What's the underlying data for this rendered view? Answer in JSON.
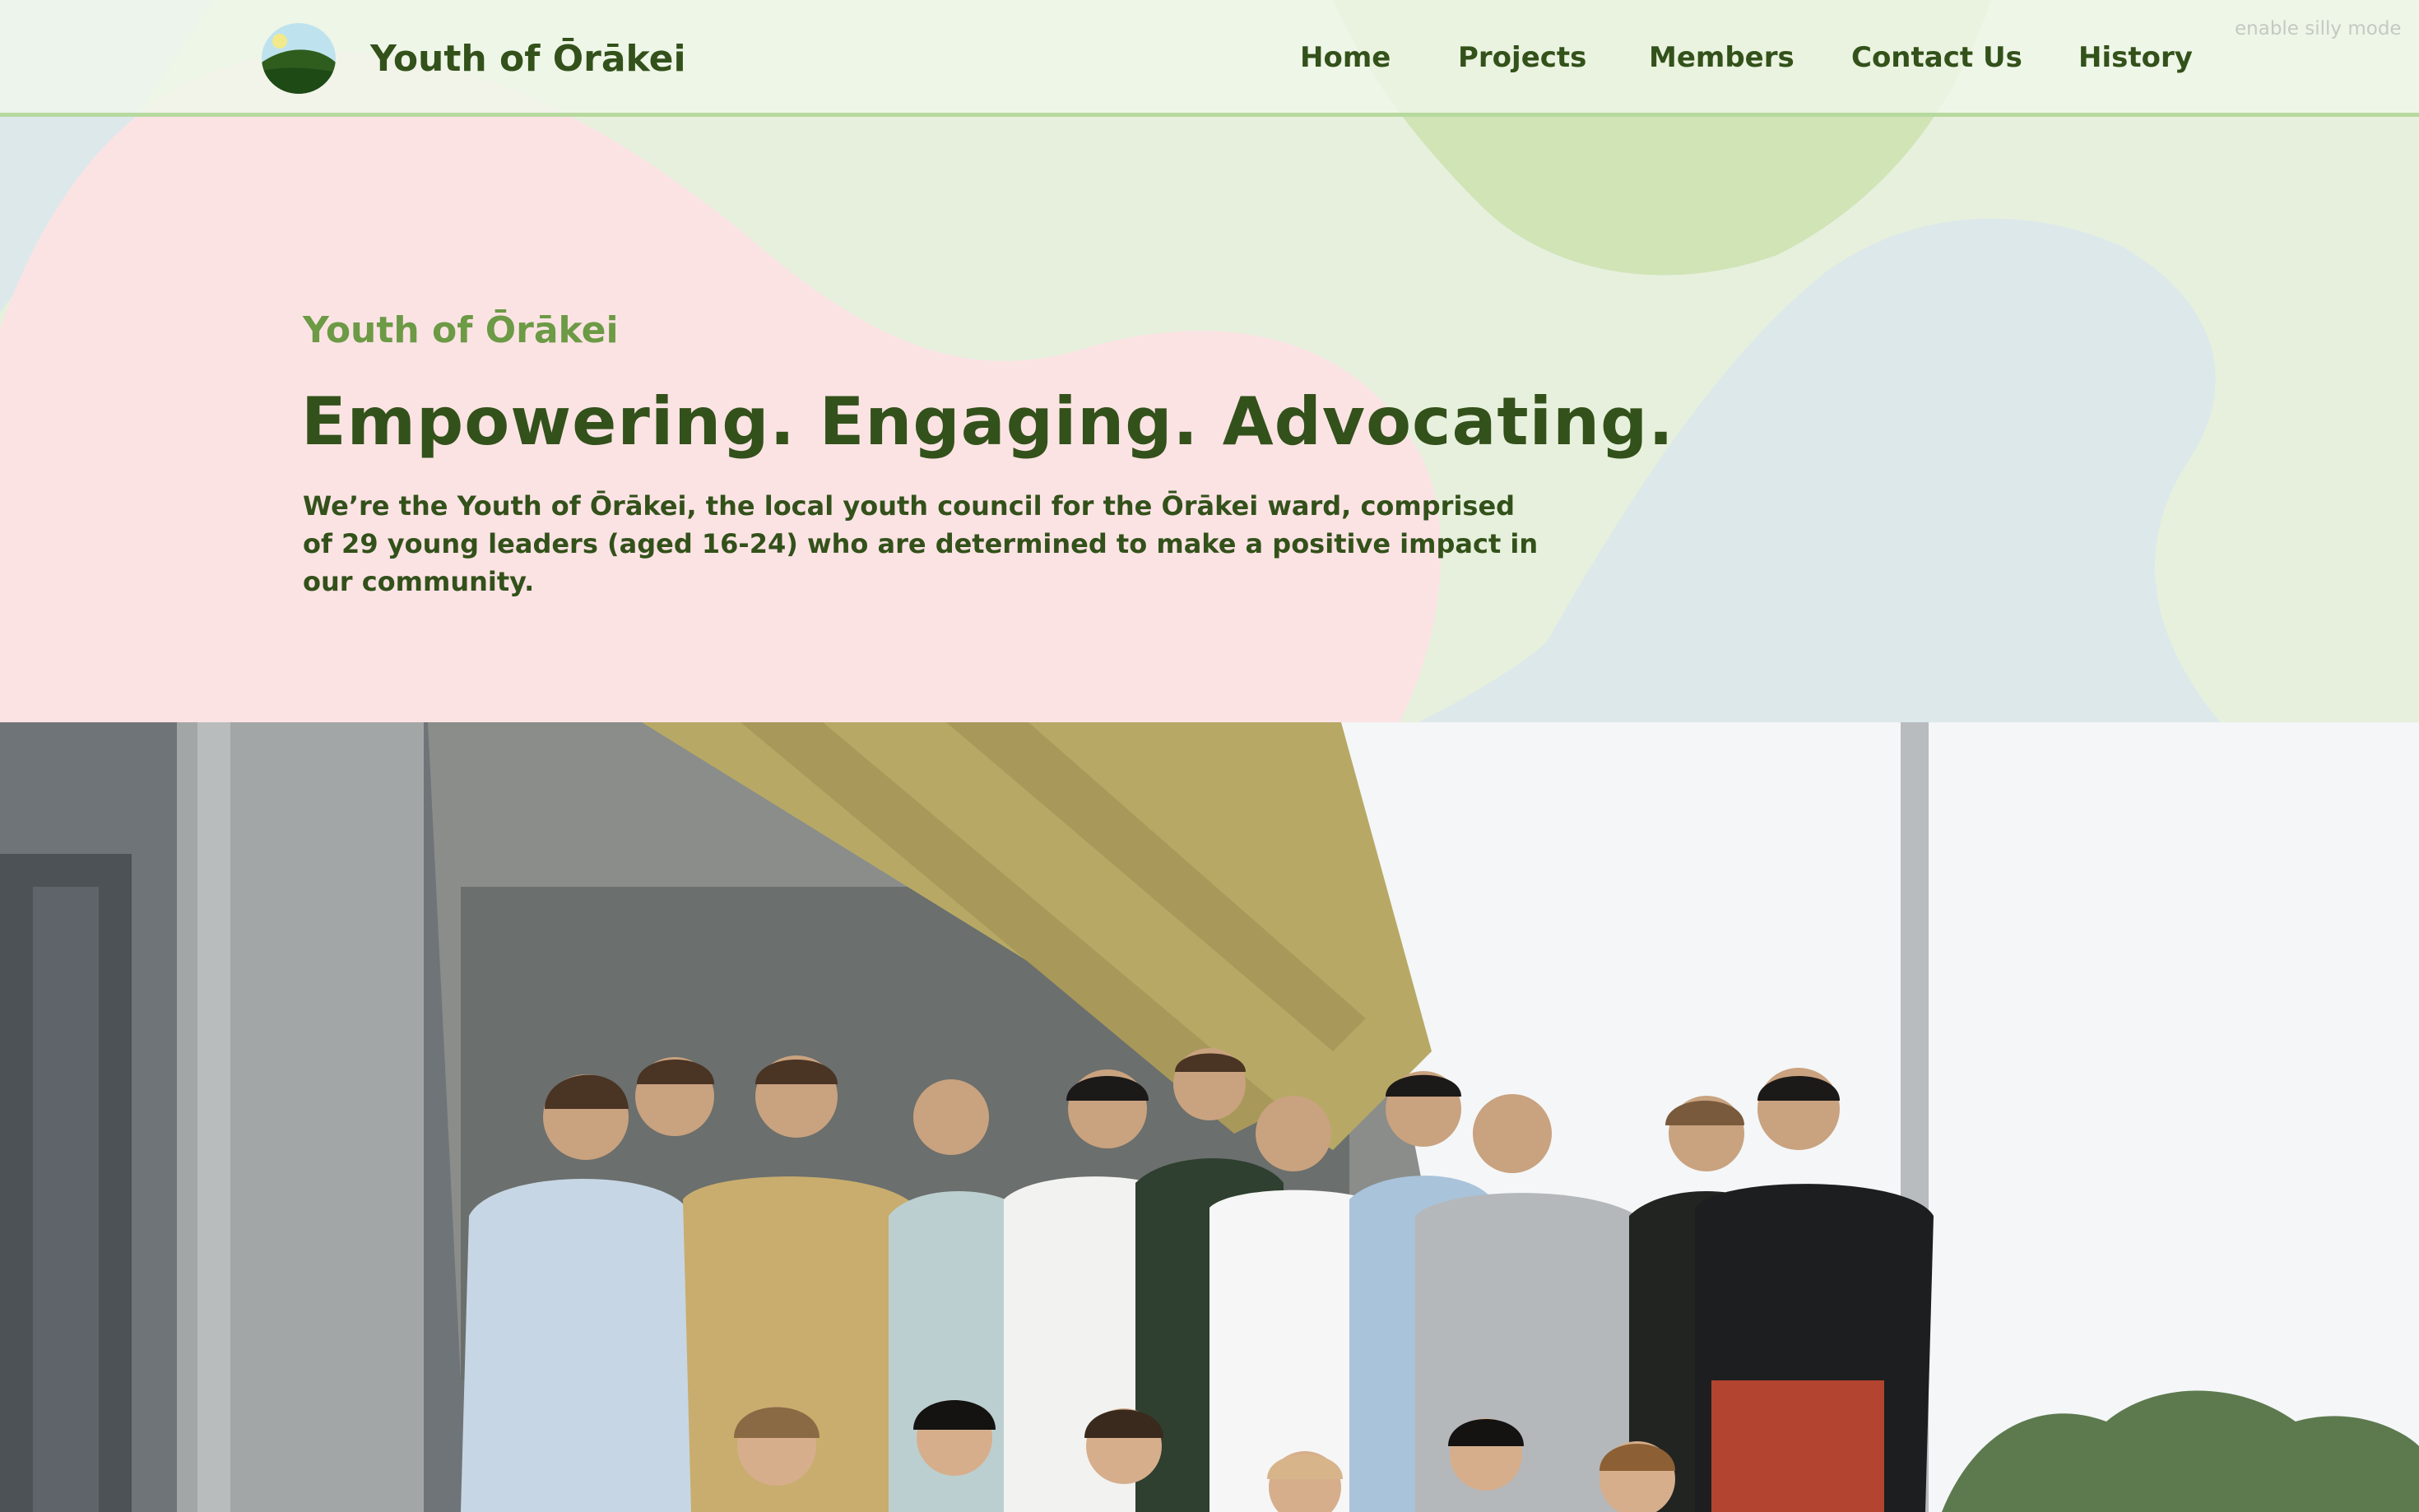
{
  "header": {
    "logo_icon": "landscape-logo-icon",
    "brand": "Youth of Ōrākei",
    "nav": [
      "Home",
      "Projects",
      "Members",
      "Contact Us",
      "History"
    ],
    "silly_mode": "enable silly mode"
  },
  "hero": {
    "eyebrow": "Youth of Ōrākei",
    "headline": "Empowering. Engaging. Advocating.",
    "description": "We’re the Youth of Ōrākei, the local youth council for the Ōrākei ward, comprised of 29 young leaders (aged 16-24) who are determined to make a positive impact in our community."
  },
  "photo": {
    "subject": "group-photo-image"
  },
  "colors": {
    "text_dark_green": "#33511a",
    "eyebrow_green": "#6c9a45",
    "header_border": "#b7d99f",
    "blob_pink": "#fbe3e4",
    "blob_light_green": "#e7f0dd",
    "blob_mid_green": "#d0e4b6",
    "blob_blue": "#dde8ea"
  }
}
